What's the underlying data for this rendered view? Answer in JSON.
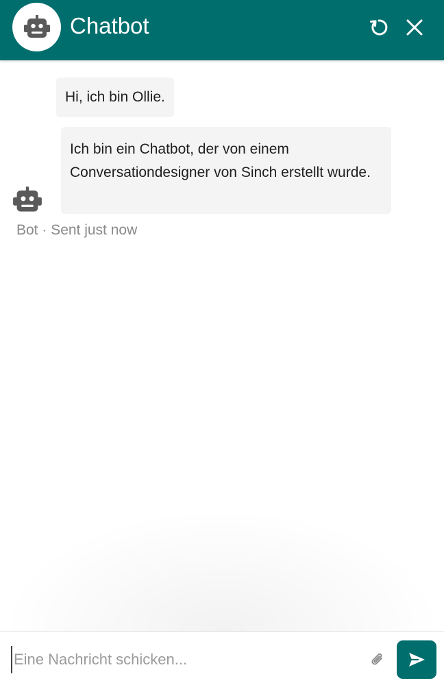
{
  "header": {
    "title": "Chatbot",
    "avatar_icon": "robot-icon",
    "restart_icon": "restart-icon",
    "close_icon": "close-icon",
    "background_color": "#006e6d"
  },
  "messages": [
    {
      "text": "Hi, ich bin Ollie."
    },
    {
      "text": "Ich bin ein Chatbot, der von einem Conversationdesigner von Sinch erstellt wurde."
    }
  ],
  "message_meta": "Bot · Sent just now",
  "composer": {
    "placeholder": "Eine Nachricht schicken...",
    "attach_icon": "paperclip-icon",
    "send_icon": "send-icon",
    "send_color": "#006e6d"
  }
}
